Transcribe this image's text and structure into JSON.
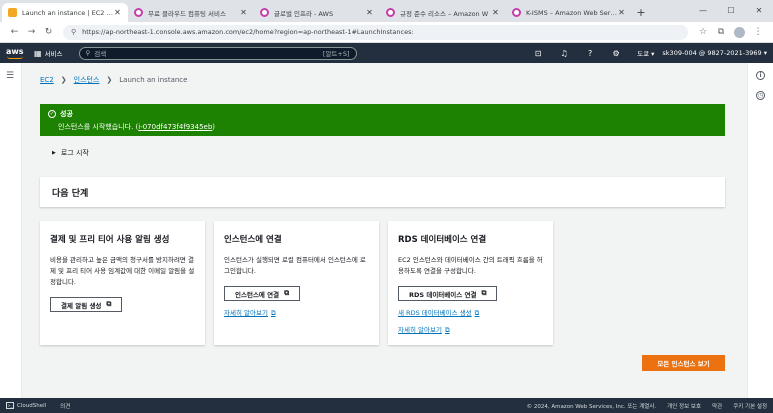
{
  "browser": {
    "tabs": [
      {
        "title": "Launch an instance | EC2 | ap-",
        "icon": "aws-favicon",
        "active": true
      },
      {
        "title": "무료 클라우드 컴퓨팅 서비스",
        "icon": "product-favicon",
        "active": false
      },
      {
        "title": "글로벌 인프라 - AWS",
        "icon": "product-favicon",
        "active": false
      },
      {
        "title": "규정 준수 리소스 – Amazon W",
        "icon": "product-favicon",
        "active": false
      },
      {
        "title": "K-ISMS – Amazon Web Service",
        "icon": "product-favicon",
        "active": false
      }
    ],
    "new_tab": "+",
    "window_controls": [
      "—",
      "☐",
      "✕"
    ],
    "url": "https://ap-northeast-1.console.aws.amazon.com/ec2/home?region=ap-northeast-1#LaunchInstances:"
  },
  "aws_nav": {
    "logo": "aws",
    "services_label": "서비스",
    "search_placeholder": "검색",
    "search_shortcut": "[알트+S]",
    "region": "도쿄 ▾",
    "account": "sk309-004 @ 9827-2021-3969 ▾"
  },
  "breadcrumb": {
    "items": [
      "EC2",
      "인스턴스",
      "Launch an instance"
    ]
  },
  "flash": {
    "title": "성공",
    "message": "인스턴스를 시작했습니다. (",
    "instance_id": "i-070df473f4f9345eb",
    "message_end": ")",
    "color": "#1d8102"
  },
  "log_toggle": "로그 시작",
  "next_steps": {
    "header": "다음 단계",
    "cards": [
      {
        "title": "결제 및 프리 티어 사용 알림 생성",
        "description": "비용을 관리하고 높은 금액의 청구서를 방지하려면 결제 및 프리 티어 사용 임계값에 대한 이메일 알림을 설정합니다.",
        "button": "결제 알림 생성",
        "links": []
      },
      {
        "title": "인스턴스에 연결",
        "description": "인스턴스가 실행되면 로컬 컴퓨터에서 인스턴스에 로그인합니다.",
        "button": "인스턴스에 연결",
        "links": [
          "자세히 알아보기"
        ]
      },
      {
        "title": "RDS 데이터베이스 연결",
        "description": "EC2 인스턴스와 데이터베이스 간의 트래픽 흐름을 허용하도록 연결을 구성합니다.",
        "button": "RDS 데이터베이스 연결",
        "links": [
          "새 RDS 데이터베이스 생성",
          "자세히 알아보기"
        ]
      }
    ]
  },
  "primary_button": {
    "label": "모든 인스턴스 보기",
    "color": "#ec7211"
  },
  "footer": {
    "cloudshell": "CloudShell",
    "feedback": "의견",
    "copyright": "© 2024, Amazon Web Services, Inc. 또는 계열사.",
    "privacy": "개인 정보 보호",
    "terms": "약관",
    "cookies": "쿠키 기본 설정"
  }
}
